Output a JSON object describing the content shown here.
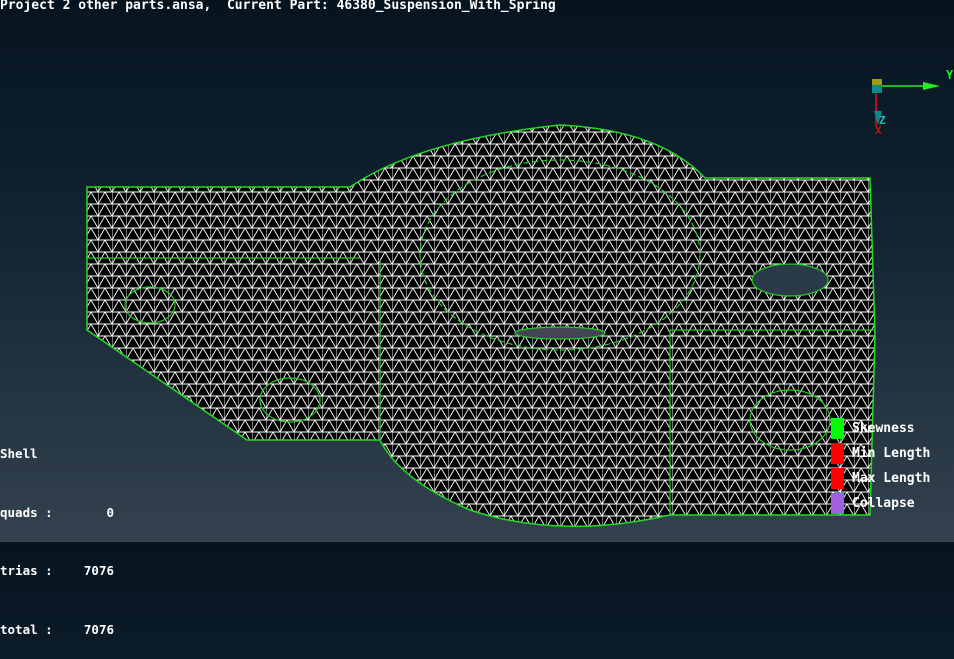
{
  "header": {
    "project": "Project 2 other parts.ansa,",
    "current_part_label": "Current Part:",
    "current_part": "46380_Suspension_With_Spring"
  },
  "stats": {
    "title": "Shell",
    "rows": [
      {
        "label": "quads :",
        "value": "0"
      },
      {
        "label": "trias :",
        "value": "7076"
      },
      {
        "label": "total :",
        "value": "7076"
      }
    ]
  },
  "legend": [
    {
      "label": "Skewness",
      "color": "#00ff00"
    },
    {
      "label": "Min Length",
      "color": "#ff0000"
    },
    {
      "label": "Max Length",
      "color": "#ff0000"
    },
    {
      "label": "Collapse",
      "color": "#a060e0"
    }
  ],
  "triad": {
    "y": "Y",
    "z": "Z",
    "x": "X"
  }
}
